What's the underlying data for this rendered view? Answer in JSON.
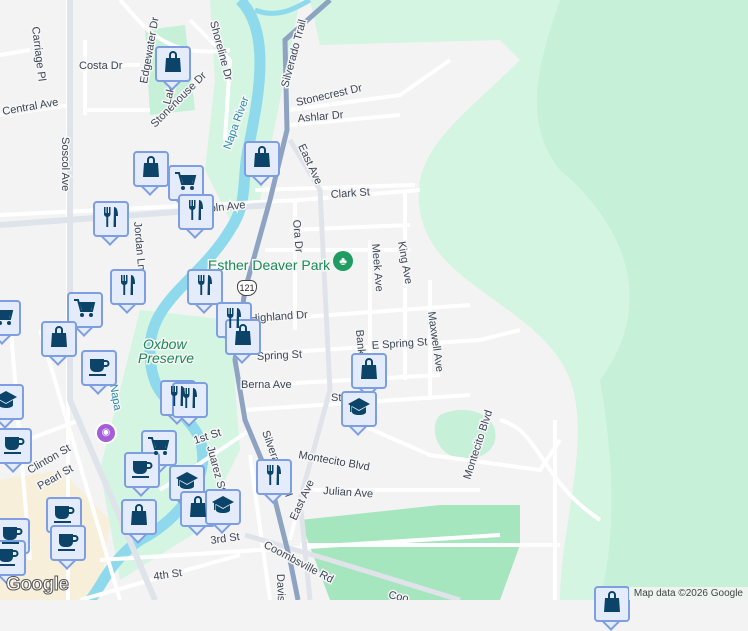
{
  "map": {
    "streets": [
      "Carriage Pl",
      "Costa Dr",
      "Edgewater Dr",
      "Shoreline Dr",
      "Central Ave",
      "Stonehouse Dr",
      "Lake",
      "Soscol Ave",
      "Silverado Trail",
      "Stonecrest Dr",
      "Ashlar Dr",
      "East Ave",
      "Clark St",
      "Lincoln Ave",
      "Jordan Ln",
      "Ora Dr",
      "Meek Ave",
      "King Ave",
      "Highland Dr",
      "E Spring St",
      "Spring St",
      "Maxwell Ave",
      "Bank",
      "Berna Ave",
      "St",
      "1st St",
      "Juarez St",
      "Clinton St",
      "Pearl St",
      "Montecito Blvd",
      "Julian Ave",
      "East Ave",
      "3rd St",
      "4th St",
      "Coombsville Rd",
      "Davis",
      "Montecito Blvd",
      "Coo",
      "Silverado Trail"
    ],
    "water": [
      "Napa River",
      "Napa"
    ],
    "parks": [
      "Esther Deaver Park",
      "Oxbow",
      "Preserve"
    ],
    "route_shield": "121",
    "google_logo": "Google",
    "attribution": "Map data ©2026 Google"
  },
  "markers": [
    {
      "type": "shopping"
    },
    {
      "type": "shopping"
    },
    {
      "type": "grocery"
    },
    {
      "type": "shopping"
    },
    {
      "type": "restaurant"
    },
    {
      "type": "restaurant"
    },
    {
      "type": "grocery"
    },
    {
      "type": "restaurant"
    },
    {
      "type": "restaurant"
    },
    {
      "type": "grocery"
    },
    {
      "type": "shopping"
    },
    {
      "type": "restaurant"
    },
    {
      "type": "shopping"
    },
    {
      "type": "cafe"
    },
    {
      "type": "school"
    },
    {
      "type": "restaurant"
    },
    {
      "type": "restaurant"
    },
    {
      "type": "cafe"
    },
    {
      "type": "grocery"
    },
    {
      "type": "cafe"
    },
    {
      "type": "school"
    },
    {
      "type": "cafe"
    },
    {
      "type": "shopping"
    },
    {
      "type": "shopping"
    },
    {
      "type": "school"
    },
    {
      "type": "restaurant"
    },
    {
      "type": "shopping"
    },
    {
      "type": "school"
    },
    {
      "type": "cafe"
    },
    {
      "type": "cafe"
    },
    {
      "type": "cafe"
    },
    {
      "type": "shopping"
    }
  ],
  "colors": {
    "marker_icon": "#0b4468",
    "marker_bg": "#e4ecfc",
    "marker_border": "#7d9ee0",
    "water": "#8fd9ec",
    "park": "#bfeed3",
    "road_major": "#8da3c1"
  }
}
